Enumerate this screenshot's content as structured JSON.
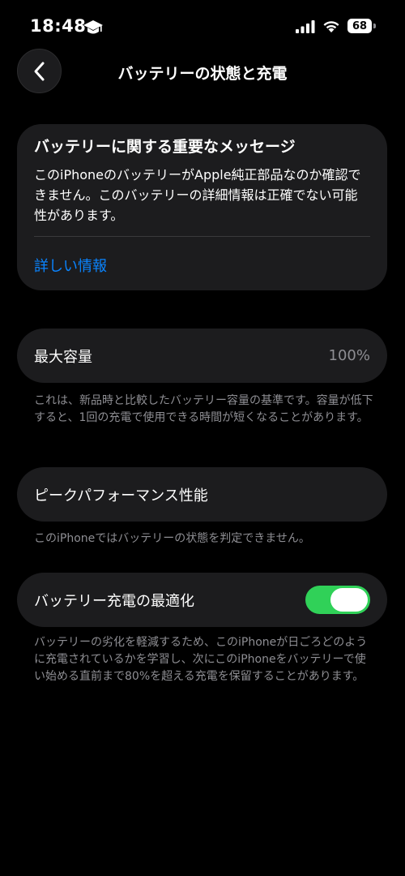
{
  "status_bar": {
    "time": "18:48",
    "battery_level": "68",
    "icons": [
      "graduation-cap-icon",
      "signal-icon",
      "wifi-icon",
      "battery-icon"
    ]
  },
  "nav": {
    "back_icon": "chevron-left-icon",
    "title": "バッテリーの状態と充電"
  },
  "message_card": {
    "title": "バッテリーに関する重要なメッセージ",
    "body": "このiPhoneのバッテリーがApple純正部品なのか確認できません。このバッテリーの詳細情報は正確でない可能性があります。",
    "link": "詳しい情報"
  },
  "capacity": {
    "label": "最大容量",
    "value": "100%",
    "note": "これは、新品時と比較したバッテリー容量の基準です。容量が低下すると、1回の充電で使用できる時間が短くなることがあります。"
  },
  "peak": {
    "label": "ピークパフォーマンス性能",
    "note": "このiPhoneではバッテリーの状態を判定できません。"
  },
  "optimize": {
    "label": "バッテリー充電の最適化",
    "enabled": true,
    "note": "バッテリーの劣化を軽減するため、このiPhoneが日ごろどのように充電されているかを学習し、次にこのiPhoneをバッテリーで使い始める直前まで80%を超える充電を保留することがあります。"
  },
  "colors": {
    "background": "#000000",
    "card": "#1c1c1e",
    "link": "#0a84ff",
    "toggle_on": "#30d158",
    "secondary_text": "#8e8e93"
  }
}
